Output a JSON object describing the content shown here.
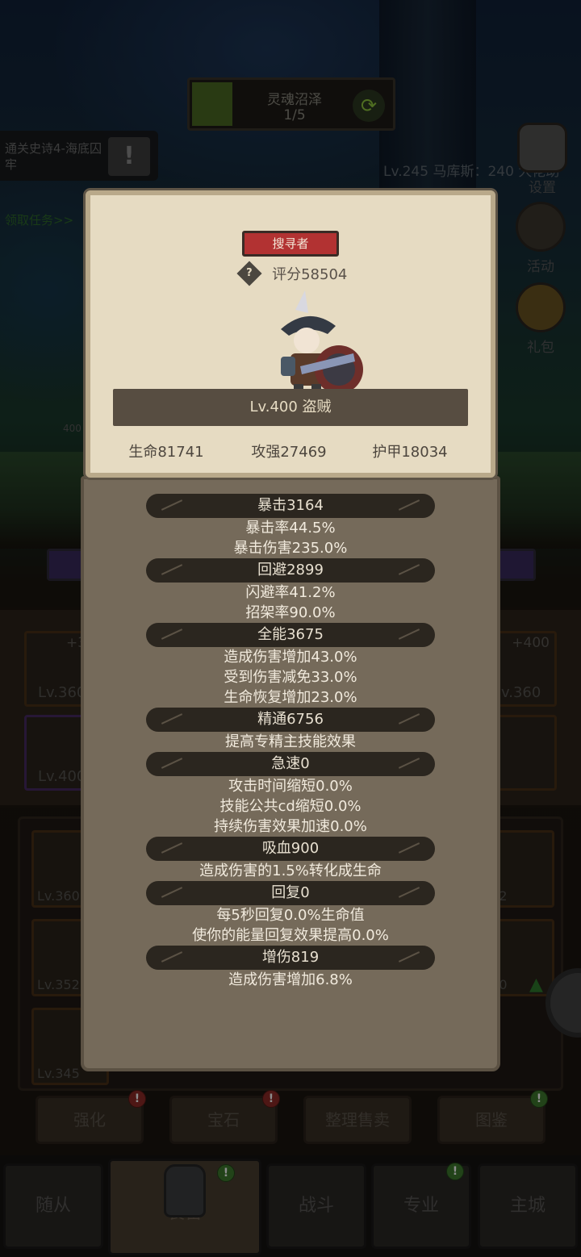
{
  "zone": {
    "name": "灵魂沼泽",
    "progress": "1/5"
  },
  "quest": {
    "text": "通关史诗4-海底囚牢",
    "alert": "!",
    "claim": "领取任务>>"
  },
  "player_line": "Lv.245 马库斯：240 大佬助",
  "side_menu": {
    "settings": "设置",
    "activity": "活动",
    "gift": "礼包"
  },
  "equipment": {
    "slots": [
      {
        "level": "Lv.360",
        "plus": "+3"
      },
      {
        "level": "Lv.400",
        "plus": ""
      },
      {
        "level": "v.360",
        "plus": "+400"
      },
      {
        "level": "",
        "plus": ""
      }
    ],
    "bag": [
      "Lv.360",
      "Lv.352",
      "Lv.345",
      "352",
      "390"
    ],
    "partial_level": "400"
  },
  "actions": [
    "强化",
    "宝石",
    "整理售卖",
    "图鉴"
  ],
  "nav": [
    "随从",
    "装备",
    "战斗",
    "专业",
    "主城"
  ],
  "character": {
    "role": "搜寻者",
    "score": "评分58504",
    "level_class": "Lv.400 盗贼",
    "stats": {
      "hp": "生命81741",
      "attack": "攻强27469",
      "armor": "护甲18034"
    }
  },
  "attributes": [
    {
      "name": "暴击3164",
      "details": [
        "暴击率44.5%",
        "暴击伤害235.0%"
      ]
    },
    {
      "name": "回避2899",
      "details": [
        "闪避率41.2%",
        "招架率90.0%"
      ]
    },
    {
      "name": "全能3675",
      "details": [
        "造成伤害增加43.0%",
        "受到伤害减免33.0%",
        "生命恢复增加23.0%"
      ]
    },
    {
      "name": "精通6756",
      "details": [
        "提高专精主技能效果"
      ]
    },
    {
      "name": "急速0",
      "details": [
        "攻击时间缩短0.0%",
        "技能公共cd缩短0.0%",
        "持续伤害效果加速0.0%"
      ]
    },
    {
      "name": "吸血900",
      "details": [
        "造成伤害的1.5%转化成生命"
      ]
    },
    {
      "name": "回复0",
      "details": [
        "每5秒回复0.0%生命值",
        "使你的能量回复效果提高0.0%"
      ]
    },
    {
      "name": "增伤819",
      "details": [
        "造成伤害增加6.8%"
      ]
    }
  ],
  "colors": {
    "role_badge": "#b23232",
    "parchment": "#e6dbc2",
    "panel": "#756a5a",
    "header_pill": "#2b261f"
  }
}
